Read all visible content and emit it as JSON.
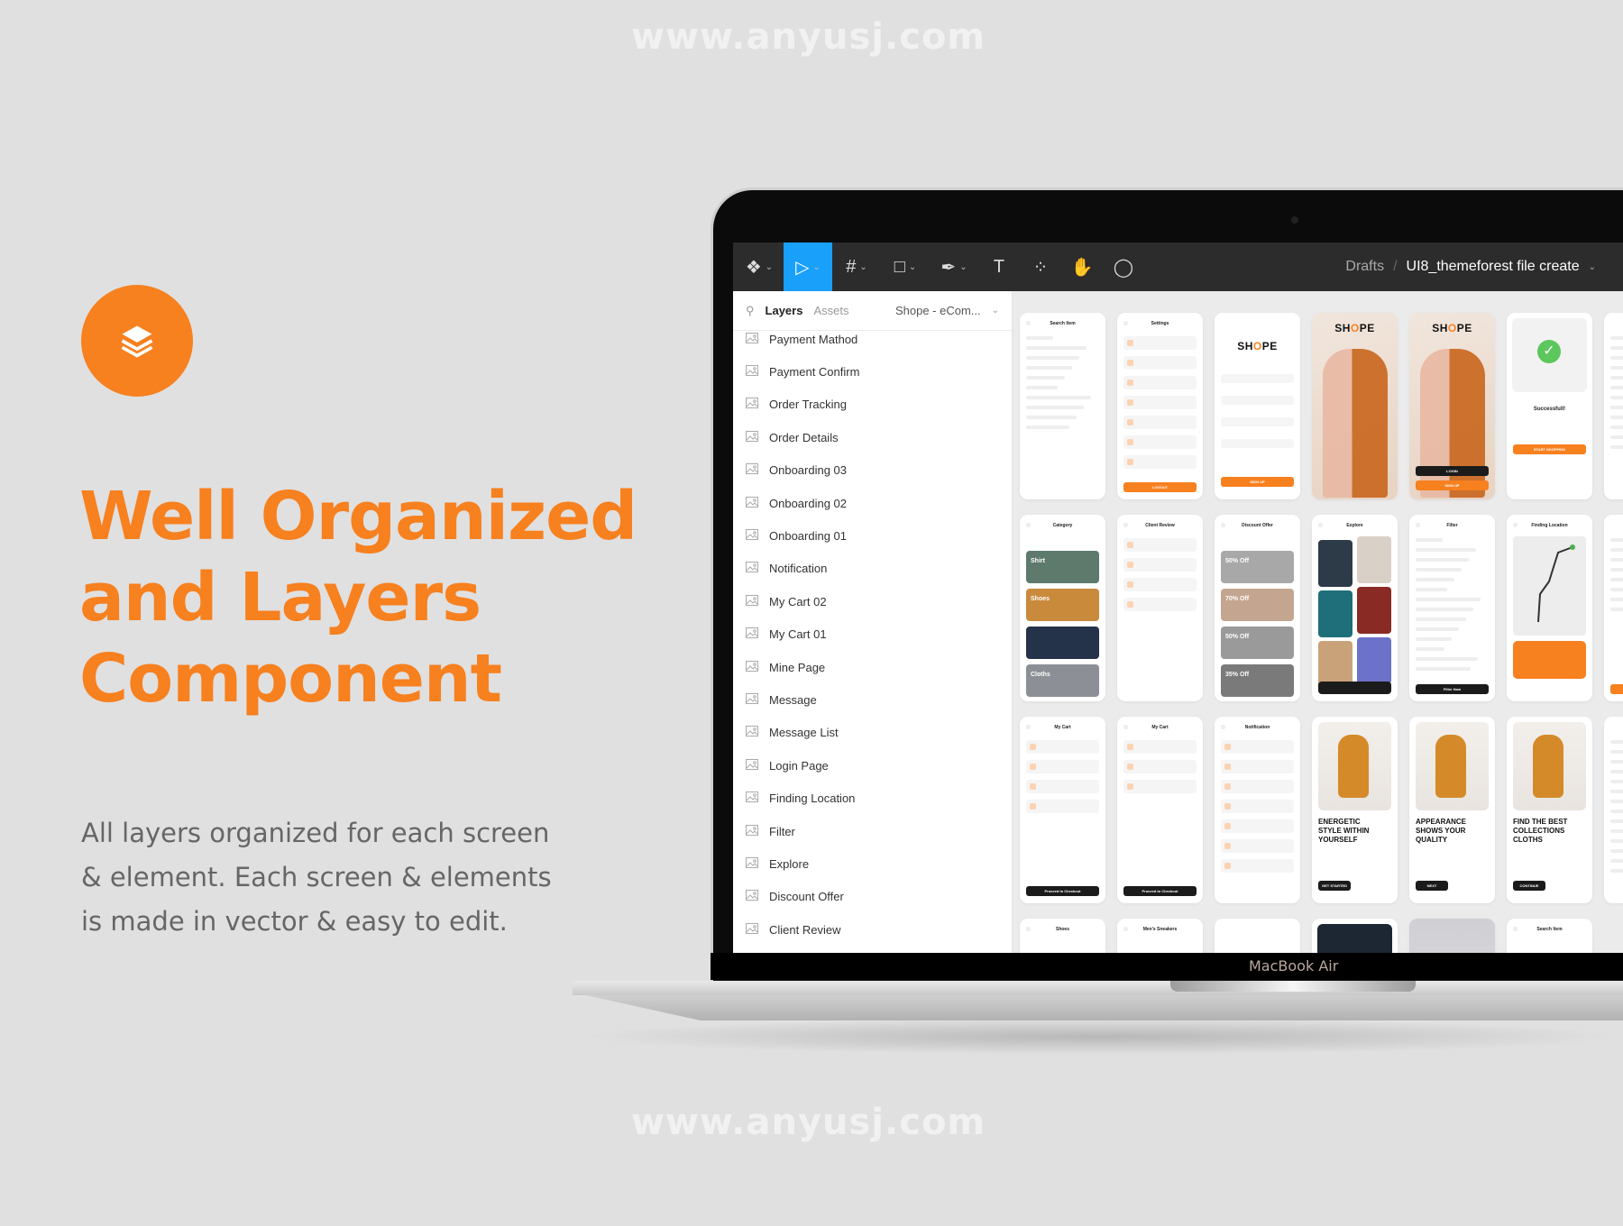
{
  "watermark": "www.anyusj.com",
  "hero": {
    "icon": "layers-icon",
    "headline": [
      "Well Organized",
      "and Layers",
      "Component"
    ],
    "description": [
      "All layers organized for each screen",
      "& element. Each screen & elements",
      "is made in vector & easy to edit."
    ]
  },
  "colors": {
    "accent": "#f7801f",
    "toolbar": "#2c2c2c",
    "active_tool": "#18a0fb",
    "background": "#e0e0e0"
  },
  "device_label": "MacBook Air",
  "toolbar": {
    "tools": [
      {
        "icon": "figma-menu-icon",
        "glyph": "❖",
        "caret": true
      },
      {
        "icon": "move-tool-icon",
        "glyph": "▷",
        "caret": true,
        "active": true
      },
      {
        "icon": "frame-tool-icon",
        "glyph": "#",
        "caret": true
      },
      {
        "icon": "rectangle-tool-icon",
        "glyph": "□",
        "caret": true
      },
      {
        "icon": "pen-tool-icon",
        "glyph": "✒",
        "caret": true
      },
      {
        "icon": "text-tool-icon",
        "glyph": "T",
        "caret": false
      },
      {
        "icon": "components-icon",
        "glyph": "⁘",
        "caret": false
      },
      {
        "icon": "hand-tool-icon",
        "glyph": "✋",
        "caret": false
      },
      {
        "icon": "comment-tool-icon",
        "glyph": "◯",
        "caret": false
      }
    ],
    "breadcrumb": {
      "folder": "Drafts",
      "separator": "/",
      "file": "UI8_themeforest file create"
    }
  },
  "layers_panel": {
    "tabs": {
      "layers": "Layers",
      "assets": "Assets"
    },
    "page": "Shope - eCom...",
    "items": [
      "Payment Mathod",
      "Payment Confirm",
      "Order Tracking",
      "Order Details",
      "Onboarding 03",
      "Onboarding 02",
      "Onboarding 01",
      "Notification",
      "My Cart 02",
      "My Cart 01",
      "Mine Page",
      "Message",
      "Message List",
      "Login Page",
      "Finding Location",
      "Filter",
      "Explore",
      "Discount Offer",
      "Client Review"
    ]
  },
  "canvas": {
    "rows": [
      [
        {
          "kind": "list",
          "title": "Search Item",
          "rows": 0,
          "lines": 10
        },
        {
          "kind": "list",
          "title": "Settings",
          "rows": 7,
          "button": "LOGOUT",
          "btncolor": "#f7801f"
        },
        {
          "kind": "brand",
          "logo": [
            "SH",
            "O",
            "PE"
          ],
          "button": "SIGN UP",
          "btncolor": "#f7801f"
        },
        {
          "kind": "photo",
          "logo": [
            "SH",
            "O",
            "PE"
          ]
        },
        {
          "kind": "photo",
          "logo": [
            "SH",
            "O",
            "PE"
          ],
          "button": "LOGIN",
          "btncolor": "#1b1b1b",
          "button2": "SIGN UP"
        },
        {
          "kind": "success",
          "title": "Successfull!",
          "button": "START SHOPPING",
          "btncolor": "#f7801f"
        },
        {
          "kind": "list",
          "title": "",
          "rows": 0,
          "lines": 12
        }
      ],
      [
        {
          "kind": "tiles",
          "title": "Category",
          "tiles": [
            {
              "label": "Shirt",
              "color": "#5d7a6d"
            },
            {
              "label": "Shoes",
              "color": "#c98a3c"
            },
            {
              "label": "",
              "color": "#24324a"
            },
            {
              "label": "Cloths",
              "color": "#8c9096"
            }
          ]
        },
        {
          "kind": "list",
          "title": "Client Review",
          "rows": 4
        },
        {
          "kind": "tiles",
          "title": "Discount Offer",
          "tiles": [
            {
              "label": "50% Off",
              "color": "#a8a8a8"
            },
            {
              "label": "70% Off",
              "color": "#c4a690"
            },
            {
              "label": "50% Off",
              "color": "#9a9a9a"
            },
            {
              "label": "35% Off",
              "color": "#7a7a7a"
            }
          ]
        },
        {
          "kind": "grid",
          "title": "Explore"
        },
        {
          "kind": "list",
          "title": "Filter",
          "rows": 0,
          "lines": 14,
          "button": "Filter Now",
          "btncolor": "#1b1b1b"
        },
        {
          "kind": "map",
          "title": "Finding Location"
        },
        {
          "kind": "list",
          "title": "",
          "rows": 0,
          "lines": 8,
          "button": "",
          "btncolor": "#f7801f"
        }
      ],
      [
        {
          "kind": "list",
          "title": "My Cart",
          "rows": 4,
          "button": "Proceed to Checkout",
          "btncolor": "#1b1b1b"
        },
        {
          "kind": "list",
          "title": "My Cart",
          "rows": 3,
          "button": "Proceed to Checkout",
          "btncolor": "#1b1b1b"
        },
        {
          "kind": "list",
          "title": "Notification",
          "rows": 7
        },
        {
          "kind": "onboard",
          "headline": "ENERGETIC\nSTYLE WITHIN\nYOURSELF",
          "button": "GET STARTED"
        },
        {
          "kind": "onboard",
          "headline": "APPEARANCE\nSHOWS YOUR\nQUALITY",
          "button": "NEXT"
        },
        {
          "kind": "onboard",
          "headline": "FIND THE BEST\nCOLLECTIONS\nCLOTHS",
          "button": "CONTINUE"
        },
        {
          "kind": "list",
          "title": "",
          "rows": 0,
          "lines": 14
        }
      ],
      [
        {
          "kind": "list",
          "title": "Shoes",
          "rows": 0,
          "lines": 0
        },
        {
          "kind": "list",
          "title": "Men's Sneakers",
          "rows": 0,
          "lines": 0
        },
        {
          "kind": "list",
          "title": "",
          "rows": 0,
          "lines": 0
        },
        {
          "kind": "dark"
        },
        {
          "kind": "gray"
        },
        {
          "kind": "list",
          "title": "Search Item",
          "rows": 0,
          "lines": 0
        }
      ]
    ]
  }
}
